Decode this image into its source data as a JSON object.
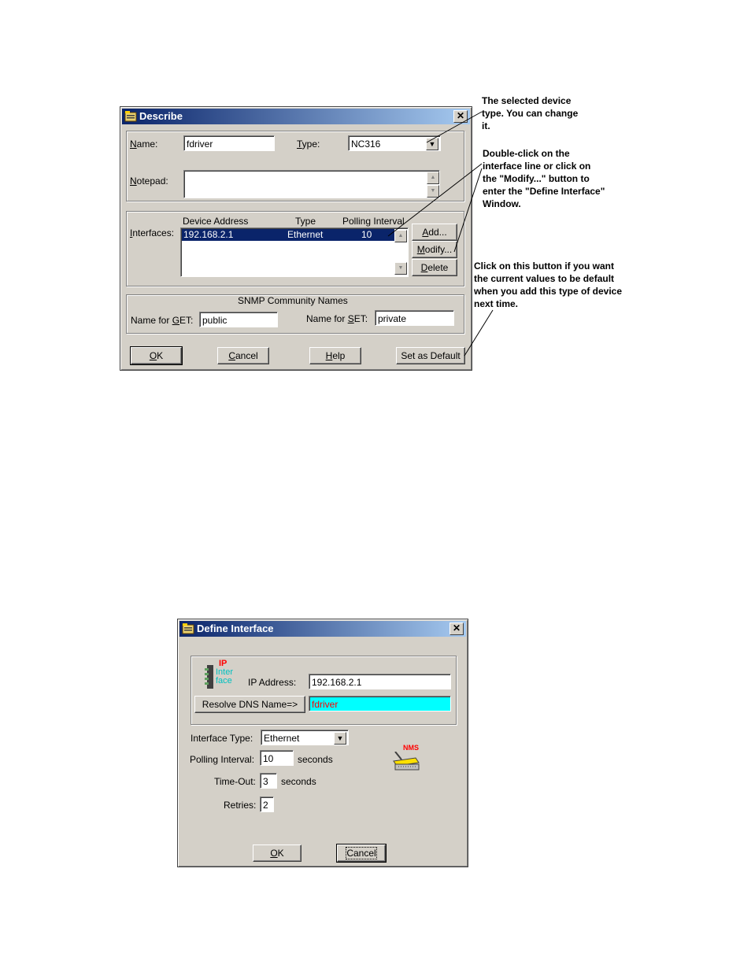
{
  "describe": {
    "title": "Describe",
    "name_label": "Name:",
    "name_value": "fdriver",
    "type_label": "Type:",
    "type_value": "NC316",
    "notepad_label": "Notepad:",
    "notepad_value": "",
    "interfaces_label": "Interfaces:",
    "columns": [
      "Device Address",
      "Type",
      "Polling Interval"
    ],
    "rows": [
      {
        "address": "192.168.2.1",
        "type": "Ethernet",
        "interval": "10"
      }
    ],
    "add_label": "Add...",
    "modify_label": "Modify...",
    "delete_label": "Delete",
    "snmp_title": "SNMP Community Names",
    "get_label": "Name for GET:",
    "get_value": "public",
    "set_label": "Name for SET:",
    "set_value": "private",
    "ok_label": "OK",
    "cancel_label": "Cancel",
    "help_label": "Help",
    "default_label": "Set as Default"
  },
  "notes": {
    "type_note": "The selected device\ntype. You can change\nit.",
    "modify_note": "Double-click on the\ninterface line or click on\nthe \"Modify...\" button to\nenter the \"Define Interface\"\nWindow.",
    "default_note": "Click on this button if you want\nthe current  values to be default\nwhen you add this type of device\nnext time."
  },
  "define": {
    "title": "Define Interface",
    "logo_ip": "IP",
    "logo_inter": "Inter",
    "logo_face": "face",
    "ip_label": "IP  Address:",
    "ip_value": "192.168.2.1",
    "resolve_label": "Resolve DNS Name=>",
    "dns_value": "fdriver",
    "iftype_label": "Interface Type:",
    "iftype_value": "Ethernet",
    "polling_label": "Polling Interval:",
    "polling_value": "10",
    "seconds1": "seconds",
    "timeout_label": "Time-Out:",
    "timeout_value": "3",
    "seconds2": "seconds",
    "retries_label": "Retries:",
    "retries_value": "2",
    "nms_label": "NMS",
    "ok_label": "OK",
    "cancel_label": "Cancel"
  },
  "colors": {
    "titlebar": "#0a246a",
    "selection": "#0a246a",
    "dns_field": "#00ffff",
    "dns_text": "#ff0000",
    "logo_red": "#ff0000",
    "logo_cyan": "#00c0c0"
  },
  "icons": [
    "app-icon",
    "close-icon",
    "chevron-down-icon",
    "scroll-up-icon",
    "scroll-down-icon",
    "interface-logo-icon",
    "nms-device-icon"
  ]
}
